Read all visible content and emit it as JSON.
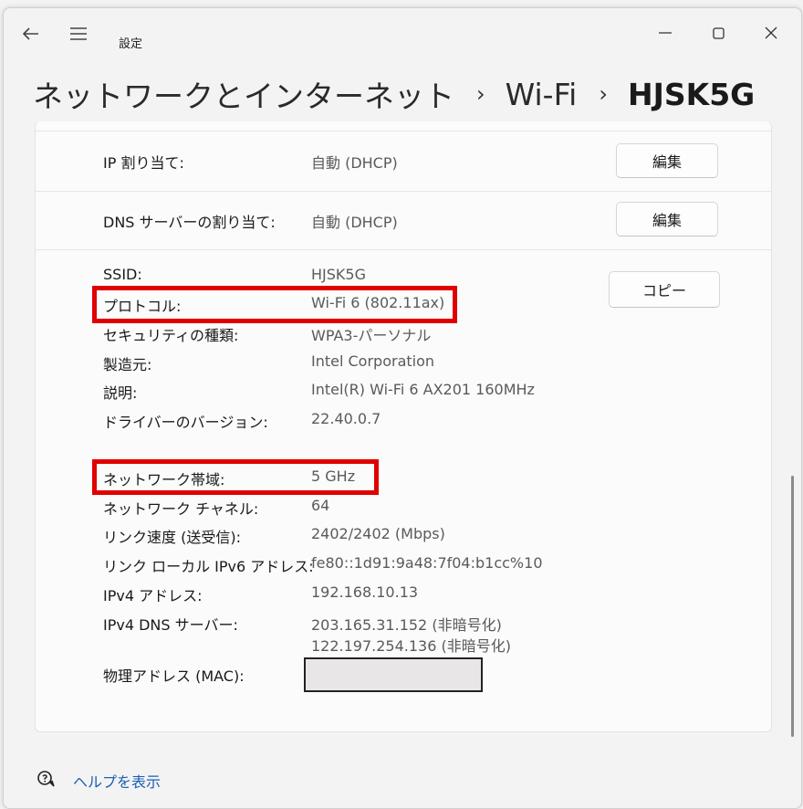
{
  "window": {
    "app_title": "設定",
    "breadcrumb": [
      "ネットワークとインターネット",
      "Wi-Fi",
      "HJSK5G"
    ],
    "breadcrumb_separator": "›",
    "window_controls": {
      "minimize": "—",
      "maximize": "☐",
      "close": "✕"
    }
  },
  "settings": {
    "ip_assignment": {
      "label": "IP 割り当て:",
      "value": "自動 (DHCP)",
      "button": "編集"
    },
    "dns_assignment": {
      "label": "DNS サーバーの割り当て:",
      "value": "自動 (DHCP)",
      "button": "編集"
    }
  },
  "copy_button": "コピー",
  "properties": [
    {
      "label": "SSID:",
      "value": "HJSK5G"
    },
    {
      "label": "プロトコル:",
      "value": "Wi-Fi 6 (802.11ax)"
    },
    {
      "label": "セキュリティの種類:",
      "value": "WPA3-パーソナル"
    },
    {
      "label": "製造元:",
      "value": "Intel Corporation"
    },
    {
      "label": "説明:",
      "value": "Intel(R) Wi-Fi 6 AX201 160MHz"
    },
    {
      "label": "ドライバーのバージョン:",
      "value": "22.40.0.7"
    },
    {
      "label": "ネットワーク帯域:",
      "value": "5 GHz"
    },
    {
      "label": "ネットワーク チャネル:",
      "value": "64"
    },
    {
      "label": "リンク速度 (送受信):",
      "value": "2402/2402 (Mbps)"
    },
    {
      "label": "リンク ローカル IPv6 アドレス:",
      "value": "fe80::1d91:9a48:7f04:b1cc%10"
    },
    {
      "label": "IPv4 アドレス:",
      "value": "192.168.10.13"
    },
    {
      "label": "IPv4 DNS サーバー:",
      "value": "203.165.31.152 (非暗号化)",
      "value2": "122.197.254.136 (非暗号化)"
    },
    {
      "label": "物理アドレス (MAC):",
      "value": ""
    }
  ],
  "footer": {
    "help_link": "ヘルプを表示"
  },
  "colors": {
    "highlight": "#e00000",
    "link": "#1a5fb4",
    "background": "#f3f3f3"
  },
  "icons": {
    "back": "back-arrow-icon",
    "menu": "hamburger-icon",
    "help": "help-chat-icon"
  }
}
